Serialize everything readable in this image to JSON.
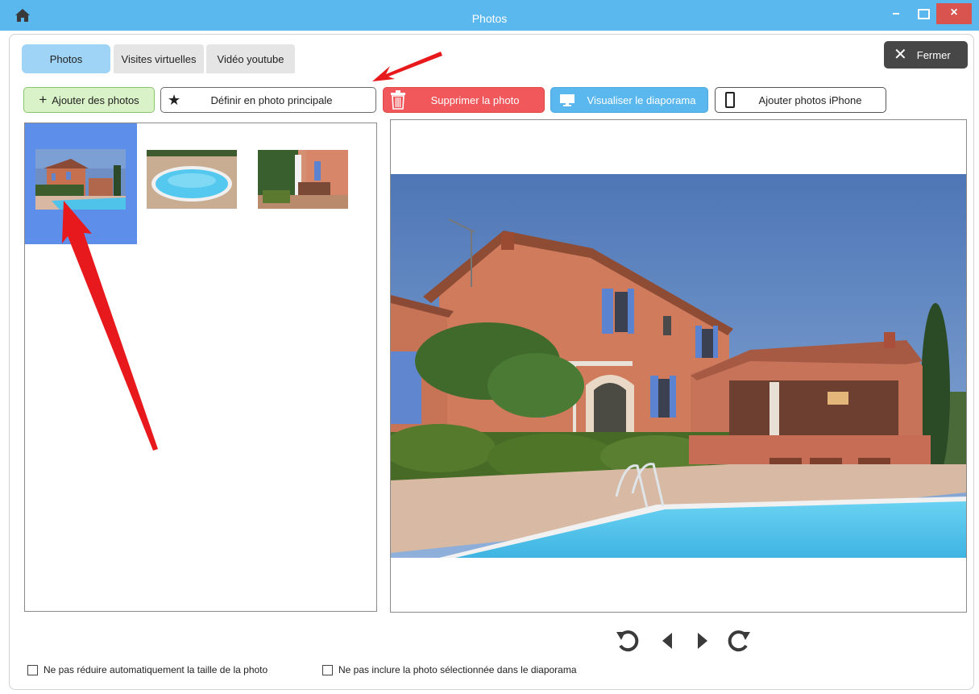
{
  "window": {
    "title": "Photos",
    "home_icon": "home-icon",
    "close_glyph": "×"
  },
  "tabs": [
    {
      "label": "Photos",
      "active": true
    },
    {
      "label": "Visites virtuelles",
      "active": false
    },
    {
      "label": "Vidéo youtube",
      "active": false
    }
  ],
  "close_button": {
    "label": "Fermer",
    "icon": "close-icon"
  },
  "toolbar": {
    "add_label": "Ajouter des photos",
    "add_icon": "plus-icon",
    "main_label": "Définir en photo principale",
    "main_icon": "star-icon",
    "delete_label": "Supprimer la photo",
    "delete_icon": "trash-icon",
    "slideshow_label": "Visualiser le diaporama",
    "slideshow_icon": "monitor-icon",
    "iphone_label": "Ajouter photos iPhone",
    "iphone_icon": "phone-icon"
  },
  "thumbnails": [
    {
      "subject": "house-with-pool",
      "selected": true
    },
    {
      "subject": "pool",
      "selected": false
    },
    {
      "subject": "terrace",
      "selected": false
    }
  ],
  "preview": {
    "subject": "house-with-pool"
  },
  "nav": {
    "rotate_left_icon": "rotate-left-icon",
    "prev_icon": "prev-icon",
    "next_icon": "next-icon",
    "rotate_right_icon": "rotate-right-icon"
  },
  "options": {
    "no_resize_label": "Ne pas réduire automatiquement la taille de la photo",
    "no_resize_checked": false,
    "exclude_label": "Ne pas inclure la photo sélectionnée dans le diaporama",
    "exclude_checked": false
  },
  "colors": {
    "titlebar": "#5bb8ee",
    "selection": "#5d8fea",
    "delete": "#f0585c",
    "slideshow": "#5bb8ee",
    "add": "#d9f2c7",
    "annotation_arrow": "#e8191c"
  }
}
